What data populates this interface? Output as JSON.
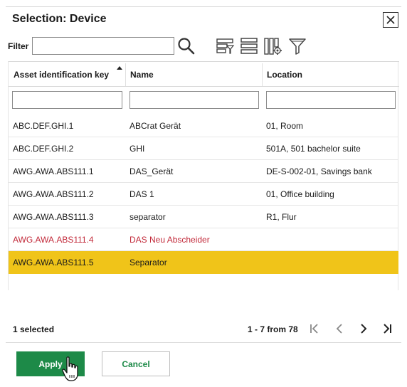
{
  "dialog": {
    "title": "Selection: Device"
  },
  "filter": {
    "label": "Filter",
    "value": "",
    "placeholder": ""
  },
  "toolbar": {
    "icons": [
      "search-icon",
      "filter-rows-icon",
      "list-view-icon",
      "column-settings-icon",
      "funnel-icon"
    ]
  },
  "table": {
    "columns": [
      {
        "label": "Asset identification key",
        "sorted": "ascending"
      },
      {
        "label": "Name"
      },
      {
        "label": "Location"
      }
    ],
    "rows": [
      {
        "key": "ABC.DEF.GHI.1",
        "name": "ABCrat Gerät",
        "location": "01, Room",
        "state": "normal"
      },
      {
        "key": "ABC.DEF.GHI.2",
        "name": "GHI",
        "location": "501A, 501 bachelor suite",
        "state": "normal"
      },
      {
        "key": "AWG.AWA.ABS111.1",
        "name": "DAS_Gerät",
        "location": "DE-S-002-01, Savings bank",
        "state": "normal"
      },
      {
        "key": "AWG.AWA.ABS111.2",
        "name": "DAS 1",
        "location": "01, Office building",
        "state": "normal"
      },
      {
        "key": "AWG.AWA.ABS111.3",
        "name": "separator",
        "location": "R1, Flur",
        "state": "normal"
      },
      {
        "key": "AWG.AWA.ABS111.4",
        "name": "DAS Neu Abscheider",
        "location": "",
        "state": "flagged"
      },
      {
        "key": "AWG.AWA.ABS111.5",
        "name": "Separator",
        "location": "",
        "state": "selected"
      }
    ]
  },
  "footer": {
    "selected_count": "1 selected",
    "paging": "1 - 7 from 78"
  },
  "buttons": {
    "apply": "Apply",
    "cancel": "Cancel"
  },
  "colors": {
    "accent_green": "#1d8a48",
    "selected_row": "#f0c419",
    "flagged_text": "#c22a3a"
  }
}
